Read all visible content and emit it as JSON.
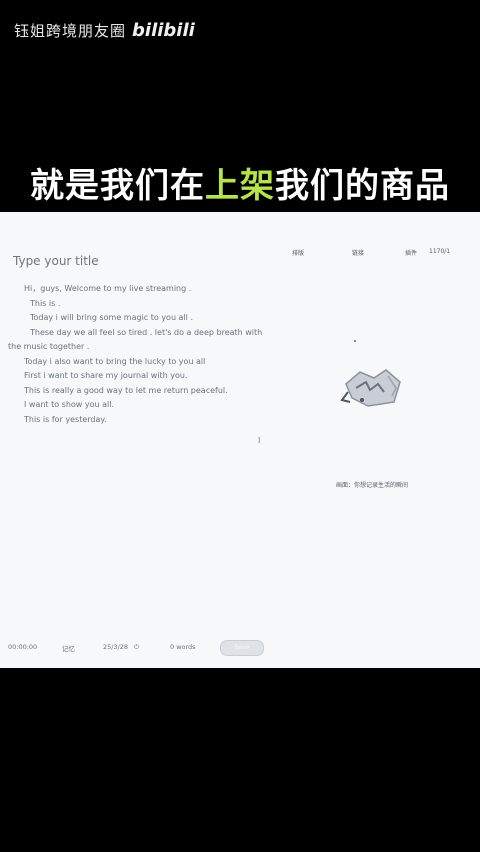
{
  "watermark": {
    "text": "钰姐跨境朋友圈",
    "logo": "bilibili"
  },
  "caption": {
    "before": "就是我们在",
    "highlight": "上架",
    "after": "我们的商品",
    "highlight_color": "#b6e34a"
  },
  "editor": {
    "title_placeholder": "Type your title",
    "top_links": [
      "排版",
      "链接",
      "插件",
      "1170/1"
    ],
    "journal_lines": [
      "Hi，guys, Welcome to my live streaming .",
      "This is  .",
      "Today i will bring some magic to you all .",
      "These day we all feel so tired . let's do a deep breath with",
      "the music together .",
      "Today i also want to bring the lucky to you all",
      "First i want to share my journal with you.",
      "This is really a good way to let me return peaceful.",
      "I want to show you all.",
      "This is for yesterday."
    ],
    "art_caption": "画面：你想记录生活的瞬间",
    "status": {
      "time": "00:00:00",
      "label1": "记忆",
      "label2": "25/3/28",
      "words": "0 words",
      "save_label": "Save"
    }
  }
}
